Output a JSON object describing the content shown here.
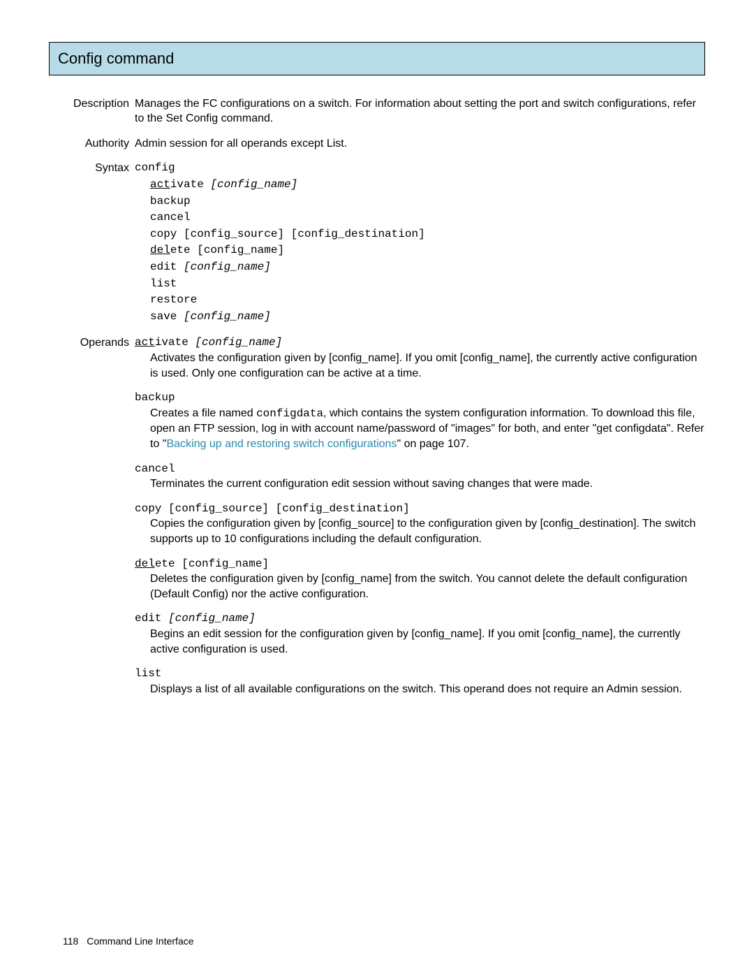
{
  "title": "Config command",
  "description": {
    "label": "Description",
    "text": "Manages the FC configurations on a switch. For information about setting the port and switch configurations, refer to the Set Config command."
  },
  "authority": {
    "label": "Authority",
    "text": "Admin session for all operands except List."
  },
  "syntax": {
    "label": "Syntax",
    "cmd": "config",
    "act_u": "act",
    "act_r": "ivate ",
    "act_arg": "[config_name]",
    "backup": "backup",
    "cancel": "cancel",
    "copy": "copy [config_source] [config_destination]",
    "del_u": "del",
    "del_r": "ete [config_name]",
    "edit": "edit ",
    "edit_arg": "[config_name]",
    "list": "list",
    "restore": "restore",
    "save": "save ",
    "save_arg": "[config_name]"
  },
  "operands": {
    "label": "Operands",
    "activate": {
      "u": "act",
      "r": "ivate ",
      "arg": "[config_name]",
      "desc": "Activates the configuration given by [config_name]. If you omit [config_name], the currently active configuration is used. Only one configuration can be active at a time."
    },
    "backup": {
      "head": "backup",
      "d1": "Creates a file named ",
      "d1m": "configdata",
      "d2": ", which contains the system configuration information. To download this file, open an FTP session, log in with account name/password of \"images\" for both, and enter \"get configdata\". Refer to \"",
      "link": "Backing up and restoring switch configurations",
      "d3": "\" on page 107."
    },
    "cancel": {
      "head": "cancel",
      "desc": "Terminates the current configuration edit session without saving changes that were made."
    },
    "copy": {
      "head": "copy [config_source] [config_destination]",
      "desc": "Copies the configuration given by [config_source] to the configuration given by [config_destination]. The switch supports up to 10 configurations including the default configuration."
    },
    "delete": {
      "u": "del",
      "r": "ete [config_name]",
      "desc": "Deletes the configuration given by [config_name] from the switch. You cannot delete the default configuration (Default Config) nor the active configuration."
    },
    "edit": {
      "h1": "edit ",
      "arg": "[config_name]",
      "desc": "Begins an edit session for the configuration given by [config_name]. If you omit [config_name], the currently active configuration is used."
    },
    "list": {
      "head": "list",
      "desc": "Displays a list of all available configurations on the switch. This operand does not require an Admin session."
    }
  },
  "footer": {
    "page": "118",
    "text": "Command Line Interface"
  }
}
